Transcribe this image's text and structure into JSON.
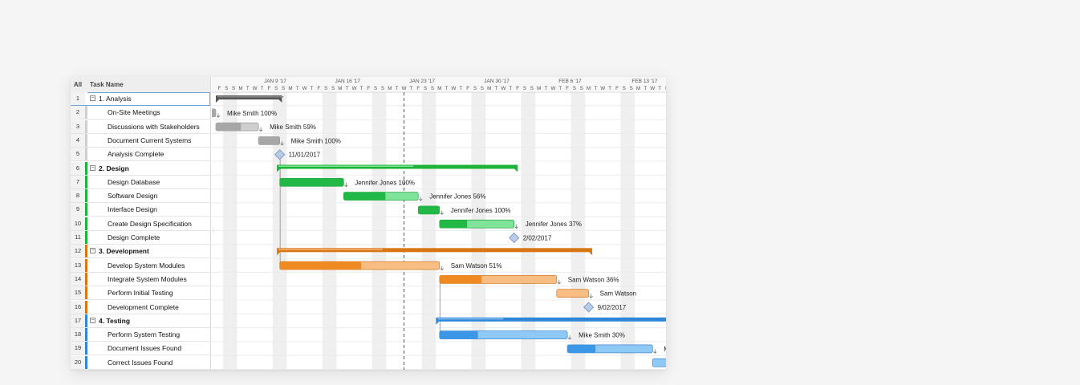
{
  "grid": {
    "header_all": "All",
    "header_name": "Task Name"
  },
  "colors": {
    "analysis": "#5a5a5a",
    "design": "#1db33a",
    "development": "#d97612",
    "testing": "#2e86d8",
    "today_line": "#555555"
  },
  "rows": [
    {
      "num": "1",
      "name": "1. Analysis",
      "kind": "summary",
      "group": "analysis"
    },
    {
      "num": "2",
      "name": "On-Site Meetings",
      "kind": "task",
      "group": "analysis"
    },
    {
      "num": "3",
      "name": "Discussions with Stakeholders",
      "kind": "task",
      "group": "analysis"
    },
    {
      "num": "4",
      "name": "Document Current Systems",
      "kind": "task",
      "group": "analysis"
    },
    {
      "num": "5",
      "name": "Analysis Complete",
      "kind": "task",
      "group": "analysis"
    },
    {
      "num": "6",
      "name": "2. Design",
      "kind": "summary",
      "group": "design"
    },
    {
      "num": "7",
      "name": "Design Database",
      "kind": "task",
      "group": "design"
    },
    {
      "num": "8",
      "name": "Software Design",
      "kind": "task",
      "group": "design"
    },
    {
      "num": "9",
      "name": "Interface Design",
      "kind": "task",
      "group": "design"
    },
    {
      "num": "10",
      "name": "Create Design Specification",
      "kind": "task",
      "group": "design"
    },
    {
      "num": "11",
      "name": "Design Complete",
      "kind": "task",
      "group": "design"
    },
    {
      "num": "12",
      "name": "3. Development",
      "kind": "summary",
      "group": "development"
    },
    {
      "num": "13",
      "name": "Develop System Modules",
      "kind": "task",
      "group": "development"
    },
    {
      "num": "14",
      "name": "Integrate System Modules",
      "kind": "task",
      "group": "development"
    },
    {
      "num": "15",
      "name": "Perform Initial Testing",
      "kind": "task",
      "group": "development"
    },
    {
      "num": "16",
      "name": "Development Complete",
      "kind": "task",
      "group": "development"
    },
    {
      "num": "17",
      "name": "4. Testing",
      "kind": "summary",
      "group": "testing"
    },
    {
      "num": "18",
      "name": "Perform System Testing",
      "kind": "task",
      "group": "testing"
    },
    {
      "num": "19",
      "name": "Document Issues Found",
      "kind": "task",
      "group": "testing"
    },
    {
      "num": "20",
      "name": "Correct Issues Found",
      "kind": "task",
      "group": "testing"
    }
  ],
  "timeline": {
    "weeks": [
      "'17",
      "JAN 9 '17",
      "JAN 16 '17",
      "JAN 23 '17",
      "JAN 30 '17",
      "FEB 6 '17",
      "FEB 13 '17"
    ],
    "day_letters": [
      "F",
      "S",
      "S",
      "M",
      "T",
      "W",
      "T",
      "F",
      "S",
      "S",
      "M",
      "T",
      "W",
      "T",
      "F",
      "S",
      "S",
      "M",
      "T",
      "W",
      "T",
      "F",
      "S",
      "S",
      "M",
      "T",
      "W",
      "T",
      "F",
      "S",
      "S",
      "M",
      "T",
      "W",
      "T",
      "F",
      "S",
      "S",
      "M",
      "T",
      "W",
      "T",
      "F",
      "S",
      "S",
      "M",
      "T",
      "W",
      "T",
      "F",
      "S",
      "S",
      "M",
      "T",
      "W",
      "T",
      "F",
      "S",
      "S",
      "M",
      "T",
      "W",
      "T",
      "F"
    ],
    "today_day": 26.5
  },
  "bars": [
    {
      "row": 0,
      "type": "summary",
      "start": 0,
      "end": 9.3,
      "progress": 1.0,
      "group": "analysis"
    },
    {
      "row": 1,
      "type": "task",
      "start": -1,
      "end": 0,
      "progress": 1.0,
      "group": "analysis",
      "label": "Mike Smith  100%",
      "color": "gray"
    },
    {
      "row": 2,
      "type": "task",
      "start": 0,
      "end": 6,
      "progress": 0.59,
      "group": "analysis",
      "label": "Mike Smith  59%",
      "color": "gray"
    },
    {
      "row": 3,
      "type": "task",
      "start": 6,
      "end": 9,
      "progress": 1.0,
      "group": "analysis",
      "label": "Mike Smith  100%",
      "color": "gray"
    },
    {
      "row": 4,
      "type": "milestone",
      "at": 9,
      "group": "analysis",
      "label": "11/01/2017"
    },
    {
      "row": 5,
      "type": "summary",
      "start": 8.6,
      "end": 42.5,
      "progress": 0.56,
      "group": "design"
    },
    {
      "row": 6,
      "type": "task",
      "start": 9,
      "end": 18,
      "progress": 1.0,
      "group": "design",
      "label": "Jennifer Jones  100%",
      "color": "green"
    },
    {
      "row": 7,
      "type": "task",
      "start": 18,
      "end": 28.5,
      "progress": 0.56,
      "group": "design",
      "label": "Jennifer Jones  56%",
      "color": "green"
    },
    {
      "row": 8,
      "type": "task",
      "start": 28.5,
      "end": 31.5,
      "progress": 1.0,
      "group": "design",
      "label": "Jennifer Jones  100%",
      "color": "green"
    },
    {
      "row": 9,
      "type": "task",
      "start": 31.5,
      "end": 42,
      "progress": 0.37,
      "group": "design",
      "label": "Jennifer Jones  37%",
      "color": "green"
    },
    {
      "row": 10,
      "type": "milestone",
      "at": 42,
      "group": "design",
      "label": "2/02/2017"
    },
    {
      "row": 11,
      "type": "summary",
      "start": 8.6,
      "end": 53,
      "progress": 0.33,
      "group": "development"
    },
    {
      "row": 12,
      "type": "task",
      "start": 9,
      "end": 31.5,
      "progress": 0.51,
      "group": "development",
      "label": "Sam Watson  51%",
      "color": "orange"
    },
    {
      "row": 13,
      "type": "task",
      "start": 31.5,
      "end": 48,
      "progress": 0.36,
      "group": "development",
      "label": "Sam Watson  36%",
      "color": "orange"
    },
    {
      "row": 14,
      "type": "task",
      "start": 48,
      "end": 52.5,
      "progress": 0,
      "group": "development",
      "label": "Sam Watson",
      "color": "orange"
    },
    {
      "row": 15,
      "type": "milestone",
      "at": 52.5,
      "group": "development",
      "label": "9/02/2017"
    },
    {
      "row": 16,
      "type": "summary",
      "start": 31,
      "end": 68,
      "progress": 0.25,
      "group": "testing"
    },
    {
      "row": 17,
      "type": "task",
      "start": 31.5,
      "end": 49.5,
      "progress": 0.3,
      "group": "testing",
      "label": "Mike Smith  30%",
      "color": "blue"
    },
    {
      "row": 18,
      "type": "task",
      "start": 49.5,
      "end": 61.5,
      "progress": 0.33,
      "group": "testing",
      "label": "Mik",
      "color": "blue"
    },
    {
      "row": 19,
      "type": "task",
      "start": 61.5,
      "end": 68,
      "progress": 0,
      "group": "testing",
      "label": "",
      "color": "blue"
    }
  ]
}
